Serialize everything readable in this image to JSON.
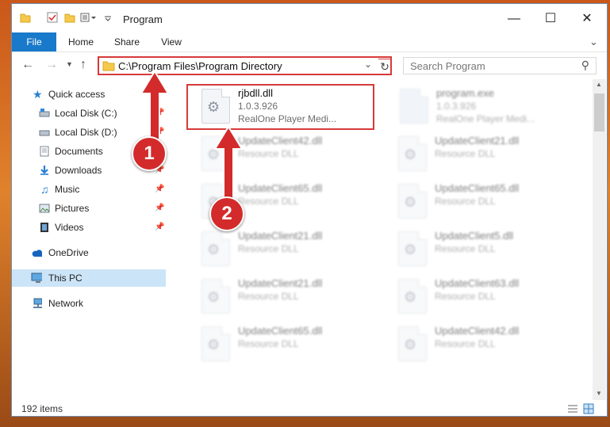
{
  "window": {
    "title": "Program",
    "tabs": [
      "File",
      "Home",
      "Share",
      "View"
    ],
    "address": "C:\\Program Files\\Program Directory",
    "search_placeholder": "Search Program"
  },
  "nav": {
    "items": [
      {
        "label": "Quick access",
        "icon": "star-icon"
      },
      {
        "label": "Local Disk (C:)",
        "icon": "drive-icon"
      },
      {
        "label": "Local Disk (D:)",
        "icon": "drive-icon"
      },
      {
        "label": "Documents",
        "icon": "documents-icon"
      },
      {
        "label": "Downloads",
        "icon": "download-icon"
      },
      {
        "label": "Music",
        "icon": "music-icon"
      },
      {
        "label": "Pictures",
        "icon": "pictures-icon"
      },
      {
        "label": "Videos",
        "icon": "videos-icon"
      },
      {
        "label": "OneDrive",
        "icon": "cloud-icon"
      },
      {
        "label": "This PC",
        "icon": "pc-icon"
      },
      {
        "label": "Network",
        "icon": "network-icon"
      }
    ]
  },
  "files": {
    "main": {
      "name": "rjbdll.dll",
      "version": "1.0.3.926",
      "desc": "RealOne Player Medi..."
    },
    "exe": {
      "name": "program.exe",
      "version": "1.0.3.926",
      "desc": "RealOne Player Medi..."
    },
    "left_col": [
      {
        "name": "UpdateClient42.dll",
        "type": "Resource DLL"
      },
      {
        "name": "UpdateClient65.dll",
        "type": "Resource DLL"
      },
      {
        "name": "UpdateClient21.dll",
        "type": "Resource DLL"
      },
      {
        "name": "UpdateClient21.dll",
        "type": "Resource DLL"
      },
      {
        "name": "UpdateClient65.dll",
        "type": "Resource DLL"
      }
    ],
    "right_col": [
      {
        "name": "UpdateClient21.dll",
        "type": "Resource DLL"
      },
      {
        "name": "UpdateClient65.dll",
        "type": "Resource DLL"
      },
      {
        "name": "UpdateClient5.dll",
        "type": "Resource DLL"
      },
      {
        "name": "UpdateClient63.dll",
        "type": "Resource DLL"
      },
      {
        "name": "UpdateClient42.dll",
        "type": "Resource DLL"
      }
    ]
  },
  "status": {
    "items": "192 items"
  },
  "annotations": {
    "one": "1",
    "two": "2"
  }
}
